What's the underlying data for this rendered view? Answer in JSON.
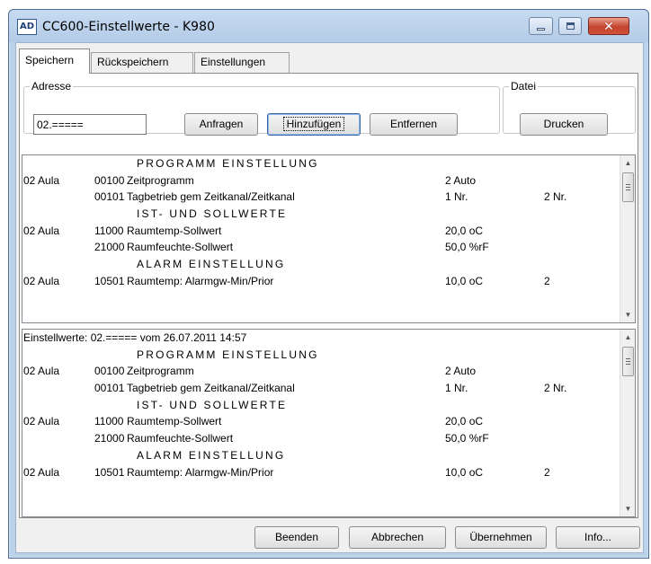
{
  "window": {
    "title": "CC600-Einstellwerte - K980",
    "icon_text": "AD",
    "close_glyph": "✕"
  },
  "tabs": [
    {
      "label": "Speichern",
      "active": true
    },
    {
      "label": "Rückspeichern",
      "active": false
    },
    {
      "label": "Einstellungen",
      "active": false
    }
  ],
  "address_group": {
    "legend": "Adresse",
    "input_value": "02.=====",
    "buttons": {
      "anfragen": "Anfragen",
      "hinzufuegen": "Hinzufügen",
      "entfernen": "Entfernen"
    }
  },
  "datei_group": {
    "legend": "Datei",
    "drucken": "Drucken"
  },
  "list1": {
    "rows": [
      {
        "type": "header",
        "text": "PROGRAMM EINSTELLUNG"
      },
      {
        "type": "data",
        "loc": "02 Aula",
        "code": "00100",
        "desc": "Zeitprogramm",
        "val": "2 Auto",
        "val2": ""
      },
      {
        "type": "data",
        "loc": "",
        "code": "00101",
        "desc": "Tagbetrieb gem Zeitkanal/Zeitkanal",
        "val": "1 Nr.",
        "val2": "2 Nr."
      },
      {
        "type": "header",
        "text": "IST- UND SOLLWERTE"
      },
      {
        "type": "data",
        "loc": "02 Aula",
        "code": "11000",
        "desc": "Raumtemp-Sollwert",
        "val": "20,0 oC",
        "val2": ""
      },
      {
        "type": "data",
        "loc": "",
        "code": "21000",
        "desc": "Raumfeuchte-Sollwert",
        "val": "50,0 %rF",
        "val2": ""
      },
      {
        "type": "header",
        "text": "ALARM EINSTELLUNG"
      },
      {
        "type": "data",
        "loc": "02 Aula",
        "code": "10501",
        "desc": "Raumtemp: Alarmgw-Min/Prior",
        "val": "10,0 oC",
        "val2": "2"
      }
    ]
  },
  "list2": {
    "rows": [
      {
        "type": "full",
        "text": "Einstellwerte: 02.===== vom 26.07.2011 14:57"
      },
      {
        "type": "header",
        "text": "PROGRAMM EINSTELLUNG"
      },
      {
        "type": "data",
        "loc": "02 Aula",
        "code": "00100",
        "desc": "Zeitprogramm",
        "val": "2 Auto",
        "val2": ""
      },
      {
        "type": "data",
        "loc": "",
        "code": "00101",
        "desc": "Tagbetrieb gem Zeitkanal/Zeitkanal",
        "val": "1 Nr.",
        "val2": "2 Nr."
      },
      {
        "type": "header",
        "text": "IST- UND SOLLWERTE"
      },
      {
        "type": "data",
        "loc": "02 Aula",
        "code": "11000",
        "desc": "Raumtemp-Sollwert",
        "val": "20,0 oC",
        "val2": ""
      },
      {
        "type": "data",
        "loc": "",
        "code": "21000",
        "desc": "Raumfeuchte-Sollwert",
        "val": "50,0 %rF",
        "val2": ""
      },
      {
        "type": "header",
        "text": "ALARM EINSTELLUNG"
      },
      {
        "type": "data",
        "loc": "02 Aula",
        "code": "10501",
        "desc": "Raumtemp: Alarmgw-Min/Prior",
        "val": "10,0 oC",
        "val2": "2"
      }
    ]
  },
  "footer": {
    "beenden": "Beenden",
    "abbrechen": "Abbrechen",
    "uebernehmen": "Übernehmen",
    "info": "Info..."
  }
}
